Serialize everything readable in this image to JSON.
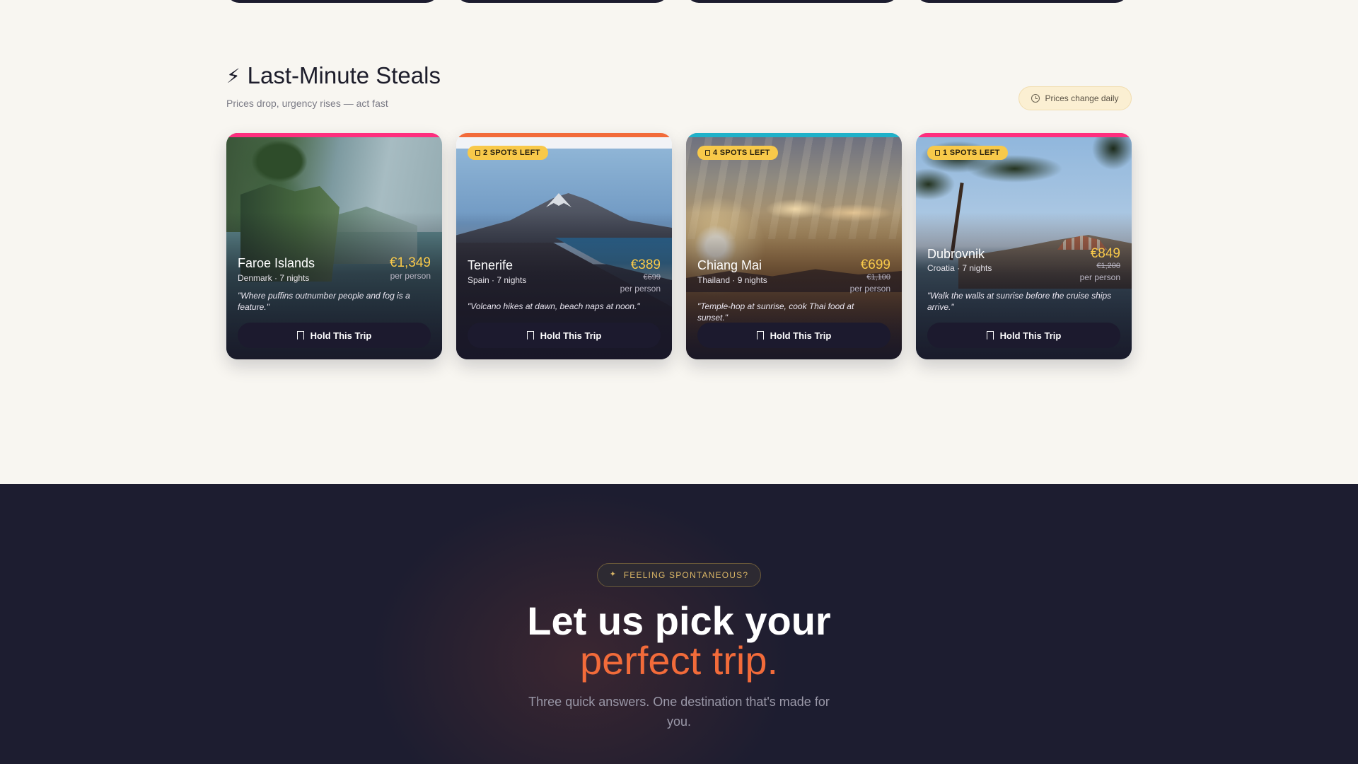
{
  "section": {
    "icon": "lightning-bolt-icon",
    "title": "Last-Minute Steals",
    "subtitle": "Prices drop, urgency rises — act fast",
    "prices_pill": {
      "icon": "clock-icon",
      "label": "Prices change daily"
    }
  },
  "cards": [
    {
      "accent": "#ff2e7e",
      "spots": "",
      "name": "Faroe Islands",
      "meta": "Denmark · 7 nights",
      "price": "€1,349",
      "old_price": "",
      "per": "per person",
      "quote": "\"Where puffins outnumber people and fog is a feature.\"",
      "button": "Hold This Trip"
    },
    {
      "accent": "#f26b3a",
      "spots": "2 SPOTS LEFT",
      "name": "Tenerife",
      "meta": "Spain · 7 nights",
      "price": "€389",
      "old_price": "€699",
      "per": "per person",
      "quote": "\"Volcano hikes at dawn, beach naps at noon.\"",
      "button": "Hold This Trip"
    },
    {
      "accent": "#1fb1c9",
      "spots": "4 SPOTS LEFT",
      "name": "Chiang Mai",
      "meta": "Thailand · 9 nights",
      "price": "€699",
      "old_price": "€1,100",
      "per": "per person",
      "quote": "\"Temple-hop at sunrise, cook Thai food at sunset.\"",
      "button": "Hold This Trip"
    },
    {
      "accent": "#ff2e7e",
      "spots": "1 SPOTS LEFT",
      "name": "Dubrovnik",
      "meta": "Croatia · 7 nights",
      "price": "€849",
      "old_price": "€1,200",
      "per": "per person",
      "quote": "\"Walk the walls at sunrise before the cruise ships arrive.\"",
      "button": "Hold This Trip"
    }
  ],
  "cta": {
    "badge": "FEELING SPONTANEOUS?",
    "badge_icon": "sparkle-icon",
    "headline_line1": "Let us pick your",
    "headline_line2": "perfect trip.",
    "subtext": "Three quick answers. One destination that's made for you."
  }
}
